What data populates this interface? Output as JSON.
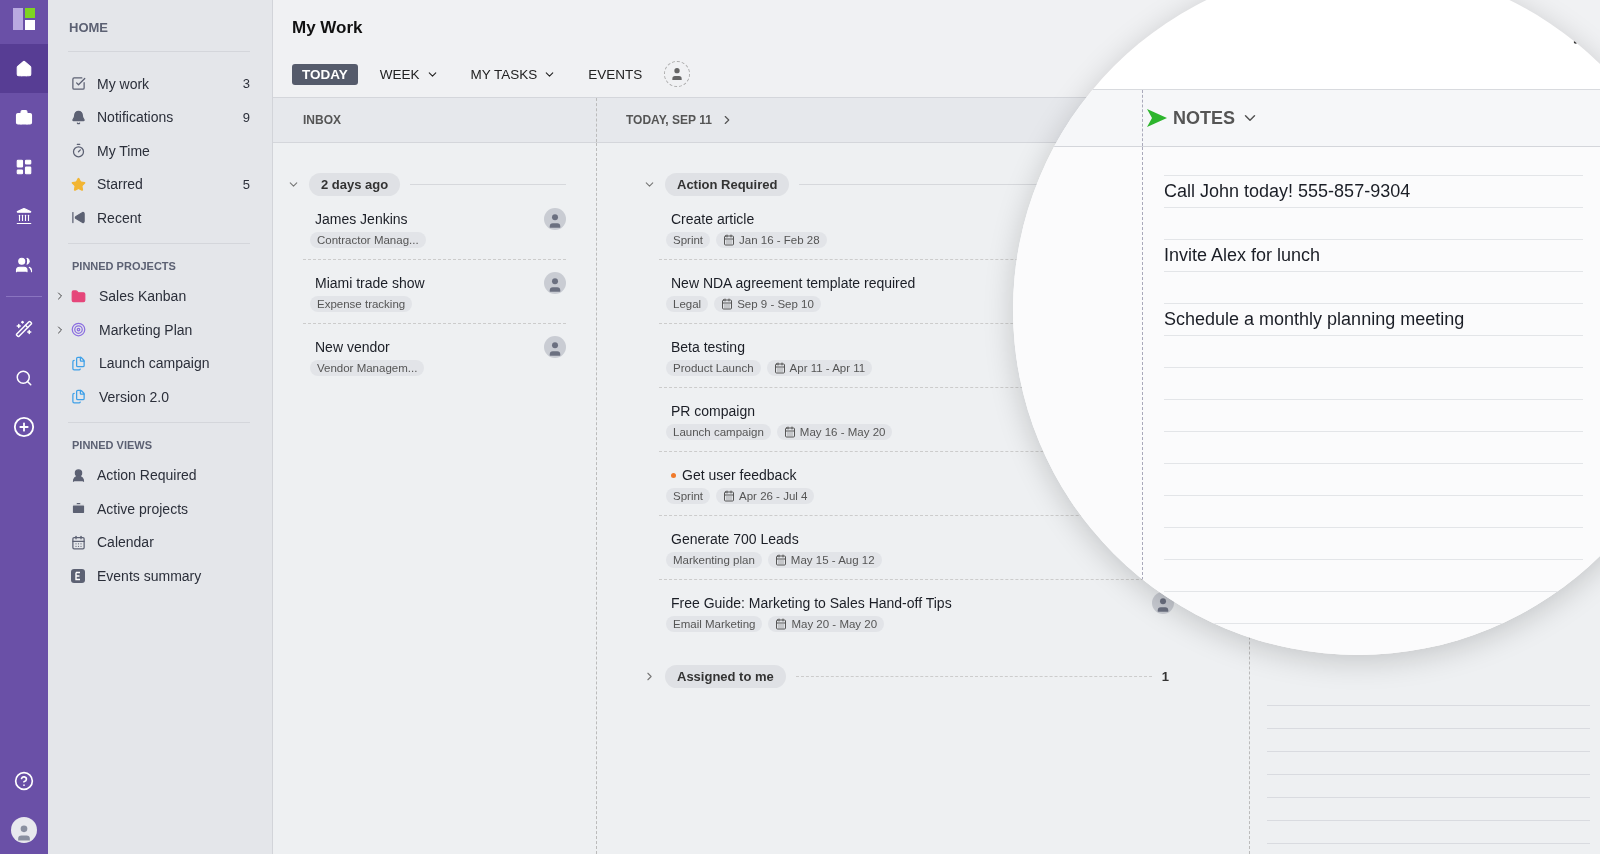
{
  "rail": {
    "items": [
      {
        "selected": true
      },
      {
        "selected": false
      },
      {
        "selected": false
      },
      {
        "selected": false
      },
      {
        "selected": false
      }
    ]
  },
  "sidebar": {
    "title": "HOME",
    "items": [
      {
        "label": "My work",
        "count": "3"
      },
      {
        "label": "Notifications",
        "count": "9"
      },
      {
        "label": "My Time"
      },
      {
        "label": "Starred",
        "count": "5"
      },
      {
        "label": "Recent"
      }
    ],
    "pinned_projects": {
      "title": "PINNED PROJECTS",
      "items": [
        {
          "label": "Sales Kanban",
          "expandable": true
        },
        {
          "label": "Marketing Plan",
          "expandable": true
        },
        {
          "label": "Launch campaign",
          "expandable": false
        },
        {
          "label": "Version 2.0",
          "expandable": false
        }
      ]
    },
    "pinned_views": {
      "title": "PINNED VIEWS",
      "items": [
        {
          "label": "Action Required"
        },
        {
          "label": "Active projects"
        },
        {
          "label": "Calendar"
        },
        {
          "label": "Events summary"
        }
      ]
    }
  },
  "header": {
    "title": "My Work",
    "tabs": [
      {
        "label": "TODAY",
        "selected": true,
        "dropdown": false
      },
      {
        "label": "WEEK",
        "selected": false,
        "dropdown": true
      },
      {
        "label": "MY TASKS",
        "selected": false,
        "dropdown": true
      },
      {
        "label": "EVENTS",
        "selected": false,
        "dropdown": false
      }
    ]
  },
  "inbox": {
    "title": "INBOX",
    "group": {
      "label": "2 days ago",
      "expanded": true
    },
    "items": [
      {
        "title": "James Jenkins",
        "tag": "Contractor Manag..."
      },
      {
        "title": "Miami trade show",
        "tag": "Expense tracking"
      },
      {
        "title": "New vendor",
        "tag": "Vendor Managem..."
      }
    ]
  },
  "today": {
    "title": "TODAY, SEP 11",
    "groups": [
      {
        "label": "Action Required",
        "expanded": true,
        "items": [
          {
            "title": "Create article",
            "tag": "Sprint",
            "dates": "Jan 16 - Feb 28",
            "flagged": false
          },
          {
            "title": "New NDA agreement template required",
            "tag": "Legal",
            "dates": "Sep 9 - Sep 10",
            "flagged": false
          },
          {
            "title": "Beta testing",
            "tag": "Product Launch",
            "dates": "Apr 11 - Apr 11",
            "flagged": false
          },
          {
            "title": "PR compaign",
            "tag": "Launch campaign",
            "dates": "May 16 - May 20",
            "flagged": false
          },
          {
            "title": "Get user feedback",
            "tag": "Sprint",
            "dates": "Apr 26 - Jul 4",
            "flagged": true
          },
          {
            "title": "Generate 700 Leads",
            "tag": "Markenting plan",
            "dates": "May 15 - Aug 12",
            "flagged": false
          },
          {
            "title": "Free Guide: Marketing to Sales Hand-off Tips",
            "tag": "Email Marketing",
            "dates": "May 20 - May 20",
            "flagged": false,
            "assignee": true
          }
        ]
      },
      {
        "label": "Assigned to me",
        "expanded": false,
        "count": "1"
      }
    ]
  },
  "notes": {
    "title": "NOTES",
    "items": [
      "Call John today! 555-857-9304",
      "Invite Alex for lunch",
      "Schedule a monthly planning meeting"
    ]
  }
}
